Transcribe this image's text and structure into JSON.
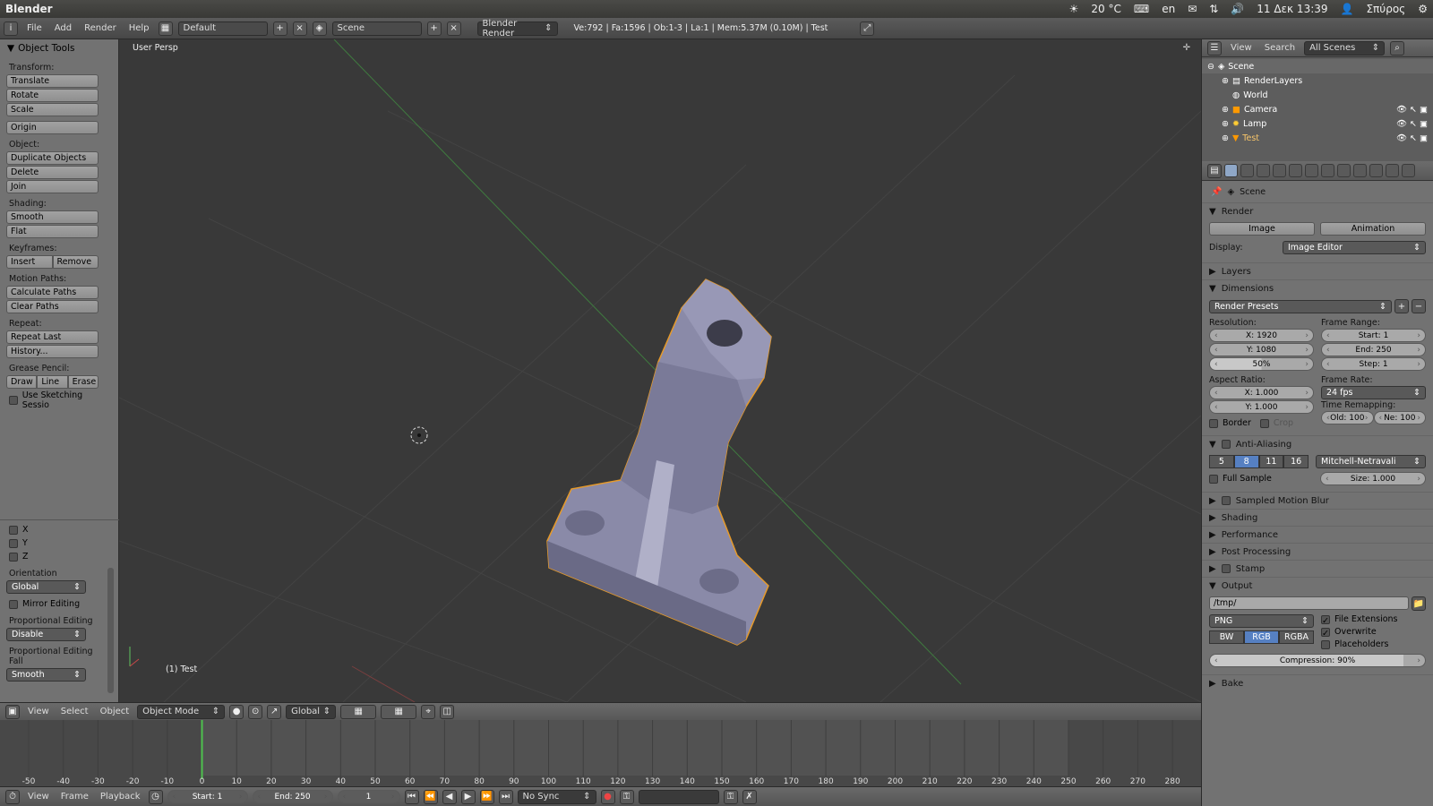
{
  "os": {
    "app_title": "Blender",
    "temp": "20 °C",
    "lang": "en",
    "datetime": "11 Δεκ 13:39",
    "user": "Σπύρος"
  },
  "info": {
    "menus": [
      "File",
      "Add",
      "Render",
      "Help"
    ],
    "layout": "Default",
    "scene": "Scene",
    "engine": "Blender Render",
    "stats": "Ve:792 | Fa:1596 | Ob:1-3 | La:1 | Mem:5.37M (0.10M) | Test"
  },
  "toolshelf": {
    "title": "Object Tools",
    "transform_label": "Transform:",
    "translate": "Translate",
    "rotate": "Rotate",
    "scale": "Scale",
    "origin": "Origin",
    "object_label": "Object:",
    "duplicate": "Duplicate Objects",
    "delete": "Delete",
    "join": "Join",
    "shading_label": "Shading:",
    "smooth": "Smooth",
    "flat": "Flat",
    "keyframes_label": "Keyframes:",
    "insert": "Insert",
    "remove": "Remove",
    "motion_label": "Motion Paths:",
    "calc_paths": "Calculate Paths",
    "clear_paths": "Clear Paths",
    "repeat_label": "Repeat:",
    "repeat_last": "Repeat Last",
    "history": "History...",
    "grease_label": "Grease Pencil:",
    "draw": "Draw",
    "line": "Line",
    "erase": "Erase",
    "sketch": "Use Sketching Sessio",
    "x": "X",
    "y": "Y",
    "z": "Z",
    "orientation_label": "Orientation",
    "orientation": "Global",
    "mirror": "Mirror Editing",
    "prop_label": "Proportional Editing",
    "prop": "Disable",
    "falloff_label": "Proportional Editing Fall",
    "falloff": "Smooth"
  },
  "viewport": {
    "title": "User Persp",
    "object_name": "(1) Test"
  },
  "vpheader": {
    "menus": [
      "View",
      "Select",
      "Object"
    ],
    "mode": "Object Mode",
    "orientation": "Global"
  },
  "timeline": {
    "ticks": [
      "-50",
      "-40",
      "-30",
      "-20",
      "-10",
      "0",
      "10",
      "20",
      "30",
      "40",
      "50",
      "60",
      "70",
      "80",
      "90",
      "100",
      "110",
      "120",
      "130",
      "140",
      "150",
      "160",
      "170",
      "180",
      "190",
      "200",
      "210",
      "220",
      "230",
      "240",
      "250",
      "260",
      "270",
      "280"
    ],
    "menus": [
      "View",
      "Frame",
      "Playback"
    ],
    "start": "Start: 1",
    "end": "End: 250",
    "current": "1",
    "sync": "No Sync"
  },
  "outliner": {
    "menus": [
      "View",
      "Search"
    ],
    "filter": "All Scenes",
    "items": [
      "Scene",
      "RenderLayers",
      "World",
      "Camera",
      "Lamp",
      "Test"
    ]
  },
  "props": {
    "context": "Scene",
    "render": {
      "title": "Render",
      "image": "Image",
      "animation": "Animation",
      "display_label": "Display:",
      "display": "Image Editor"
    },
    "layers": "Layers",
    "dims": {
      "title": "Dimensions",
      "presets": "Render Presets",
      "res_label": "Resolution:",
      "x": "X: 1920",
      "y": "Y: 1080",
      "pct": "50%",
      "fr_label": "Frame Range:",
      "start": "Start: 1",
      "end": "End: 250",
      "step": "Step: 1",
      "aspect_label": "Aspect Ratio:",
      "ax": "X: 1.000",
      "ay": "Y: 1.000",
      "rate_label": "Frame Rate:",
      "fps": "24 fps",
      "remap_label": "Time Remapping:",
      "old": "Old: 100",
      "new": "Ne: 100",
      "border": "Border",
      "crop": "Crop"
    },
    "aa": {
      "title": "Anti-Aliasing",
      "levels": [
        "5",
        "8",
        "11",
        "16"
      ],
      "filter": "Mitchell-Netravali",
      "full": "Full Sample",
      "size": "Size: 1.000"
    },
    "collapsed": [
      "Sampled Motion Blur",
      "Shading",
      "Performance",
      "Post Processing",
      "Stamp"
    ],
    "output": {
      "title": "Output",
      "path": "/tmp/",
      "format": "PNG",
      "ext": "File Extensions",
      "bw": "BW",
      "rgb": "RGB",
      "rgba": "RGBA",
      "overwrite": "Overwrite",
      "placeholders": "Placeholders",
      "compression": "Compression: 90%"
    },
    "bake": "Bake"
  }
}
